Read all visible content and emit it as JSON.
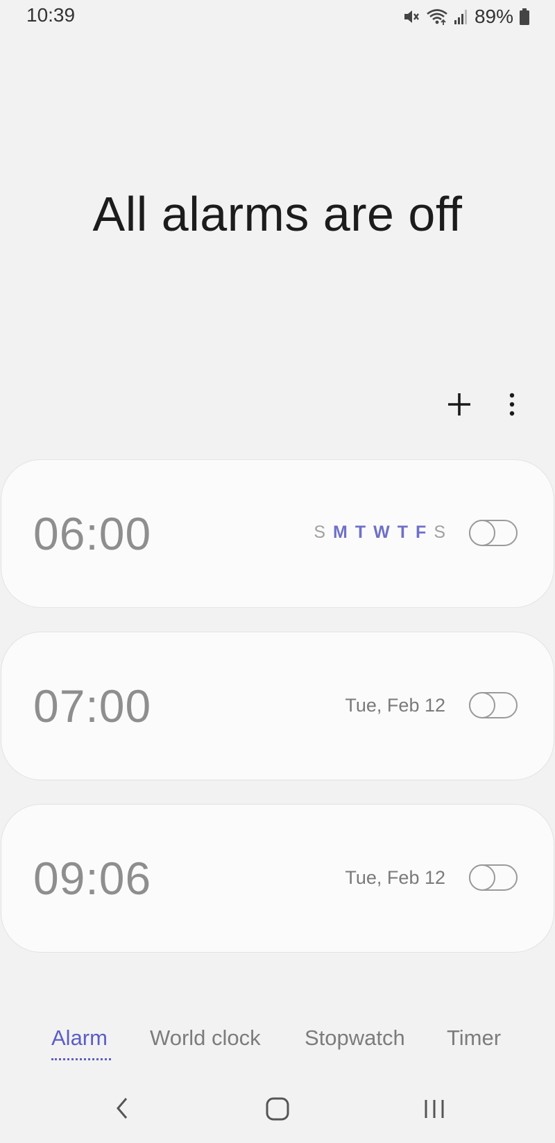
{
  "status_bar": {
    "time": "10:39",
    "battery_percent": "89%",
    "icons": [
      "mute-icon",
      "wifi-icon",
      "signal-icon",
      "battery-icon"
    ]
  },
  "header": {
    "title": "All alarms are off"
  },
  "toolbar": {
    "add_icon": "plus-icon",
    "more_icon": "more-vertical-icon"
  },
  "alarms": [
    {
      "time": "06:00",
      "days": [
        "S",
        "M",
        "T",
        "W",
        "T",
        "F",
        "S"
      ],
      "active_days": [
        false,
        true,
        true,
        true,
        true,
        true,
        false
      ],
      "enabled": false
    },
    {
      "time": "07:00",
      "date": "Tue, Feb 12",
      "enabled": false
    },
    {
      "time": "09:06",
      "date": "Tue, Feb 12",
      "enabled": false
    }
  ],
  "tabs": [
    {
      "label": "Alarm",
      "active": true
    },
    {
      "label": "World clock",
      "active": false
    },
    {
      "label": "Stopwatch",
      "active": false
    },
    {
      "label": "Timer",
      "active": false
    }
  ],
  "colors": {
    "accent": "#5b5dc7",
    "active_day": "#6f70c8",
    "background": "#f2f2f2",
    "card": "#fbfbfb"
  },
  "nav_bar": {
    "icons": [
      "back-icon",
      "home-icon",
      "recents-icon"
    ]
  }
}
